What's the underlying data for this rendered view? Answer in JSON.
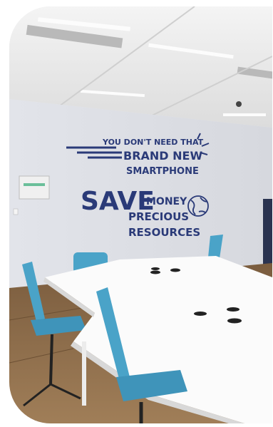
{
  "photo": {
    "wall_mural": {
      "line1": "YOU DON'T NEED THAT",
      "line2": "BRAND NEW",
      "line3": "SMARTPHONE",
      "big_word": "SAVE",
      "line4": "MONEY",
      "line5": "PRECIOUS",
      "line6": "RESOURCES",
      "icon": "globe-icon",
      "text_color": "#2a3a78"
    },
    "colors": {
      "ceiling": "#f2f2f2",
      "wall": "#e6e8ee",
      "floor": "#8a6a48",
      "table": "#fbfbfb",
      "chair": "#4aa3c8"
    }
  }
}
